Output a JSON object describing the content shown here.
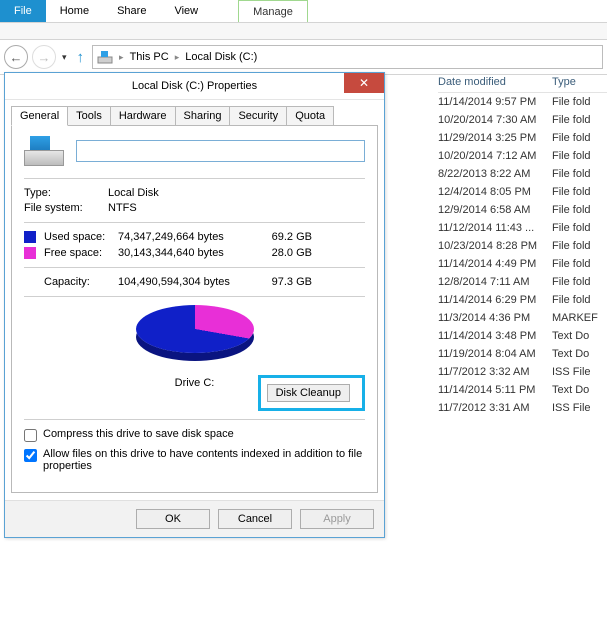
{
  "ribbon": {
    "file": "File",
    "tabs": [
      "Home",
      "Share",
      "View"
    ],
    "manage": "Manage"
  },
  "breadcrumb": {
    "items": [
      "This PC",
      "Local Disk (C:)"
    ]
  },
  "listing": {
    "headers": {
      "date": "Date modified",
      "type": "Type"
    },
    "rows": [
      {
        "date": "11/14/2014 9:57 PM",
        "type": "File fold"
      },
      {
        "date": "10/20/2014 7:30 AM",
        "type": "File fold"
      },
      {
        "date": "11/29/2014 3:25 PM",
        "type": "File fold"
      },
      {
        "date": "10/20/2014 7:12 AM",
        "type": "File fold"
      },
      {
        "date": "8/22/2013 8:22 AM",
        "type": "File fold"
      },
      {
        "date": "12/4/2014 8:05 PM",
        "type": "File fold"
      },
      {
        "date": "12/9/2014 6:58 AM",
        "type": "File fold"
      },
      {
        "date": "11/12/2014 11:43 ...",
        "type": "File fold"
      },
      {
        "date": "10/23/2014 8:28 PM",
        "type": "File fold"
      },
      {
        "date": "11/14/2014 4:49 PM",
        "type": "File fold"
      },
      {
        "date": "12/8/2014 7:11 AM",
        "type": "File fold"
      },
      {
        "date": "11/14/2014 6:29 PM",
        "type": "File fold"
      },
      {
        "date": "11/3/2014 4:36 PM",
        "type": "MARKEF"
      },
      {
        "date": "11/14/2014 3:48 PM",
        "type": "Text Do"
      },
      {
        "date": "11/19/2014 8:04 AM",
        "type": "Text Do"
      },
      {
        "date": "11/7/2012 3:32 AM",
        "type": "ISS File"
      },
      {
        "date": "11/14/2014 5:11 PM",
        "type": "Text Do"
      },
      {
        "date": "11/7/2012 3:31 AM",
        "type": "ISS File"
      }
    ]
  },
  "dialog": {
    "title": "Local Disk (C:) Properties",
    "close": "✕",
    "tabs": [
      "General",
      "Tools",
      "Hardware",
      "Sharing",
      "Security",
      "Quota"
    ],
    "general": {
      "type_label": "Type:",
      "type_value": "Local Disk",
      "fs_label": "File system:",
      "fs_value": "NTFS",
      "used": {
        "label": "Used space:",
        "bytes": "74,347,249,664 bytes",
        "gb": "69.2 GB"
      },
      "free": {
        "label": "Free space:",
        "bytes": "30,143,344,640 bytes",
        "gb": "28.0 GB"
      },
      "capacity": {
        "label": "Capacity:",
        "bytes": "104,490,594,304 bytes",
        "gb": "97.3 GB"
      },
      "drive_caption": "Drive C:",
      "cleanup": "Disk Cleanup",
      "compress": "Compress this drive to save disk space",
      "index": "Allow files on this drive to have contents indexed in addition to file properties"
    },
    "buttons": {
      "ok": "OK",
      "cancel": "Cancel",
      "apply": "Apply"
    }
  },
  "chart_data": {
    "type": "pie",
    "title": "Drive C:",
    "series": [
      {
        "name": "Used space",
        "value": 69.2,
        "color": "#1020c8"
      },
      {
        "name": "Free space",
        "value": 28.0,
        "color": "#e82fd7"
      }
    ],
    "unit": "GB",
    "total": 97.3
  }
}
